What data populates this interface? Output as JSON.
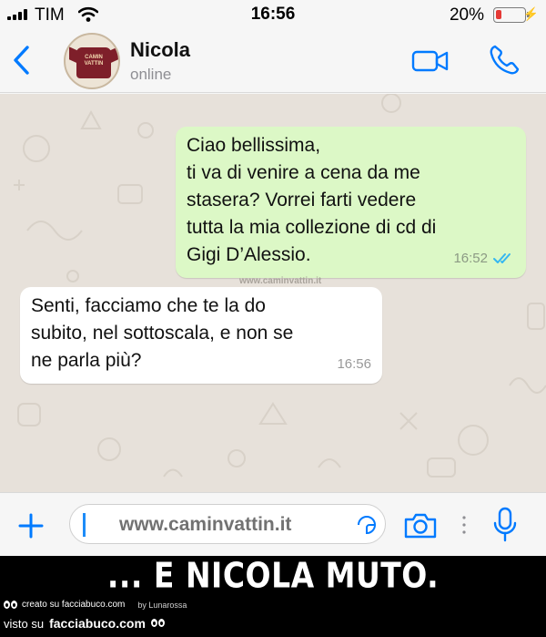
{
  "status_bar": {
    "carrier": "TIM",
    "time": "16:56",
    "battery_percent": "20%",
    "battery_level": 0.2,
    "battery_color": "#e53935"
  },
  "header": {
    "contact_name": "Nicola",
    "contact_status": "online",
    "avatar_text_line1": "CAMIN",
    "avatar_text_line2": "VATTIN",
    "accent_color": "#007aff",
    "icons": [
      "back-chevron-icon",
      "video-camera-icon",
      "phone-icon"
    ]
  },
  "chat": {
    "watermark": "www.caminvattin.it",
    "messages": [
      {
        "direction": "outgoing",
        "lines": [
          "Ciao bellissima,",
          "ti va di venire a cena da me",
          "stasera? Vorrei farti vedere",
          "tutta la mia collezione di cd di",
          "Gigi D’Alessio."
        ],
        "time": "16:52",
        "status": "read",
        "bubble_color": "#dcf8c6"
      },
      {
        "direction": "incoming",
        "lines": [
          "Senti, facciamo che te la do",
          "subito, nel sottoscala, e non se",
          "ne parla più?"
        ],
        "time": "16:56",
        "bubble_color": "#ffffff"
      }
    ]
  },
  "input_bar": {
    "text": "www.caminvattin.it",
    "icons": [
      "plus-icon",
      "sticker-icon",
      "camera-icon",
      "more-dots-icon",
      "microphone-icon"
    ]
  },
  "caption": {
    "text": "... E NICOLA MUTO."
  },
  "footer": {
    "created_on": "creato su facciabuco.com",
    "author": "by Lunarossa",
    "seen_on": "visto su",
    "site": "facciabuco.com"
  }
}
